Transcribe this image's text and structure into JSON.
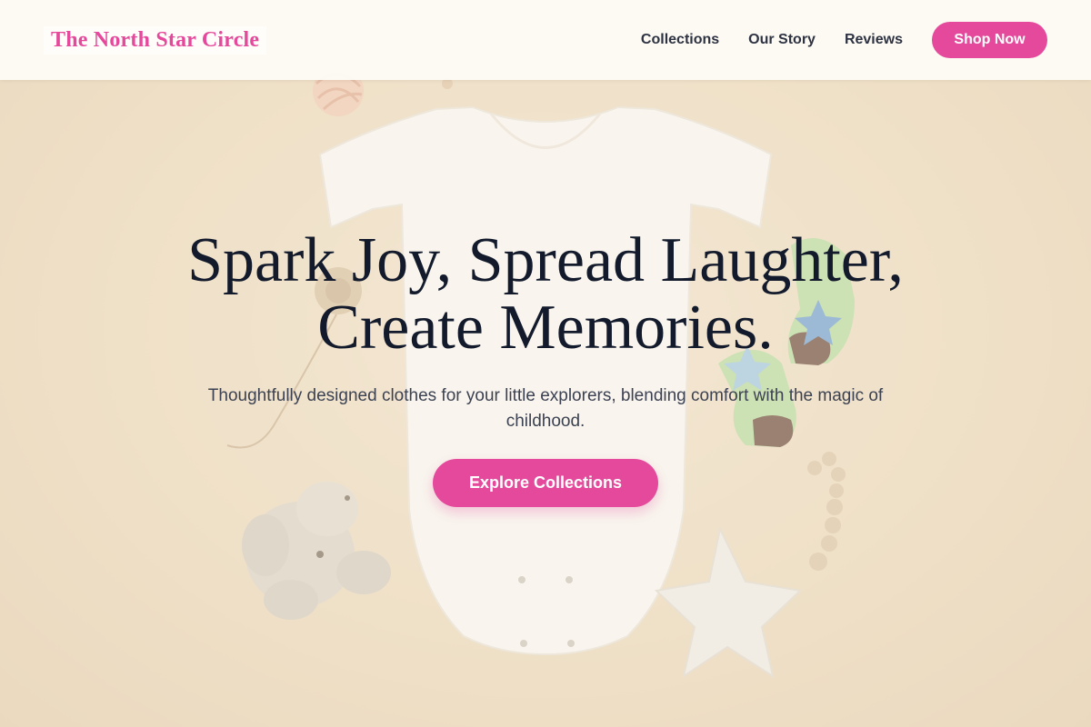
{
  "header": {
    "brand": "The North Star Circle",
    "nav": {
      "collections": "Collections",
      "story": "Our Story",
      "reviews": "Reviews"
    },
    "shop_label": "Shop Now"
  },
  "hero": {
    "title_line1": "Spark Joy, Spread Laughter,",
    "title_line2": "Create Memories.",
    "subtitle_line1": "Thoughtfully designed clothes for your little explorers, blending comfort with the magic of",
    "subtitle_line2": "childhood.",
    "cta_label": "Explore Collections"
  },
  "colors": {
    "accent": "#e4499b",
    "heading": "#121a2c",
    "background": "#efe0c6"
  }
}
